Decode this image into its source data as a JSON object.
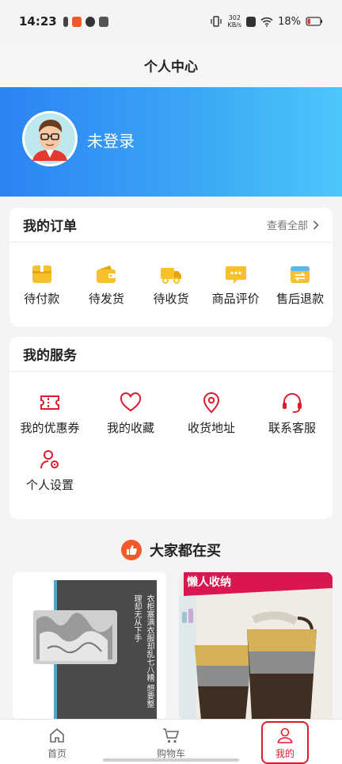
{
  "status_bar": {
    "time": "14:23",
    "speed": "302",
    "speed_unit": "KB/s",
    "battery": "18%"
  },
  "header": {
    "title": "个人中心"
  },
  "profile": {
    "login_text": "未登录"
  },
  "orders": {
    "title": "我的订单",
    "view_all": "查看全部",
    "items": [
      {
        "label": "待付款",
        "icon": "pending-payment-icon"
      },
      {
        "label": "待发货",
        "icon": "wallet-icon"
      },
      {
        "label": "待收货",
        "icon": "truck-icon"
      },
      {
        "label": "商品评价",
        "icon": "comment-icon"
      },
      {
        "label": "售后退款",
        "icon": "refund-icon"
      }
    ]
  },
  "services": {
    "title": "我的服务",
    "items": [
      {
        "label": "我的优惠券",
        "icon": "coupon-icon"
      },
      {
        "label": "我的收藏",
        "icon": "heart-icon"
      },
      {
        "label": "收货地址",
        "icon": "location-icon"
      },
      {
        "label": "联系客服",
        "icon": "headset-icon"
      },
      {
        "label": "个人设置",
        "icon": "user-settings-icon"
      }
    ]
  },
  "popular": {
    "title": "大家都在买"
  },
  "products": [
    {
      "caption": "衣柜塞满衣服却乱七八糟 想要整理却无从下手"
    },
    {
      "badge": "懒人收纳"
    }
  ],
  "tabbar": {
    "items": [
      {
        "label": "首页",
        "icon": "home-icon"
      },
      {
        "label": "购物车",
        "icon": "cart-icon"
      },
      {
        "label": "我的",
        "icon": "user-icon"
      }
    ],
    "active": "我的"
  },
  "colors": {
    "accent": "#e01b2e",
    "order_icon": "#f7c12b",
    "hero_start": "#2b83f3",
    "hero_end": "#4dc6fb"
  }
}
